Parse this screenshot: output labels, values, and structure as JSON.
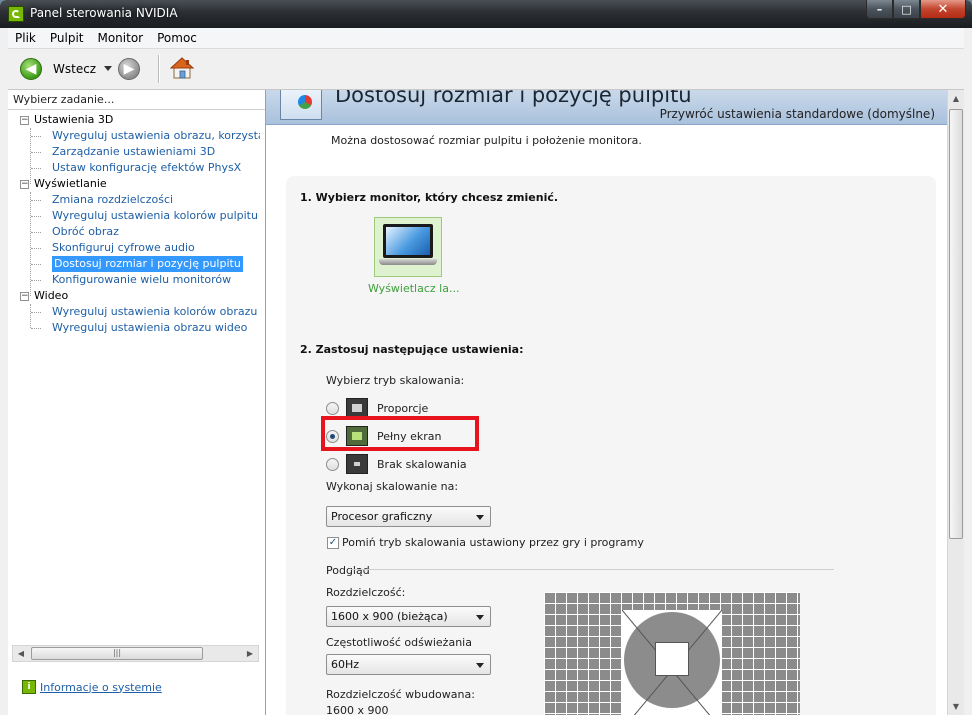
{
  "window": {
    "title": "Panel sterowania NVIDIA",
    "min": "–",
    "max": "□",
    "close": "✕"
  },
  "menu": [
    "Plik",
    "Pulpit",
    "Monitor",
    "Pomoc"
  ],
  "toolbar": {
    "back_label": "Wstecz"
  },
  "left": {
    "header": "Wybierz zadanie...",
    "tree": [
      {
        "label": "Ustawienia 3D",
        "type": "cat"
      },
      {
        "label": "Wyreguluj ustawienia obrazu, korzystając z",
        "type": "link"
      },
      {
        "label": "Zarządzanie ustawieniami 3D",
        "type": "link"
      },
      {
        "label": "Ustaw konfigurację efektów PhysX",
        "type": "link"
      },
      {
        "label": "Wyświetlanie",
        "type": "cat"
      },
      {
        "label": "Zmiana rozdzielczości",
        "type": "link"
      },
      {
        "label": "Wyreguluj ustawienia kolorów pulpitu",
        "type": "link"
      },
      {
        "label": "Obróć obraz",
        "type": "link"
      },
      {
        "label": "Skonfiguruj cyfrowe audio",
        "type": "link"
      },
      {
        "label": "Dostosuj rozmiar i pozycję pulpitu",
        "type": "link",
        "selected": true
      },
      {
        "label": "Konfigurowanie wielu monitorów",
        "type": "link"
      },
      {
        "label": "Wideo",
        "type": "cat"
      },
      {
        "label": "Wyreguluj ustawienia kolorów obrazu wideo",
        "type": "link"
      },
      {
        "label": "Wyreguluj ustawienia obrazu wideo",
        "type": "link"
      }
    ],
    "sysinfo": "Informacje o systemie"
  },
  "main": {
    "title": "Dostosuj rozmiar i pozycję pulpitu",
    "restore": "Przywróć ustawienia standardowe (domyślne)",
    "description": "Można dostosować rozmiar pulpitu i położenie monitora.",
    "step1": "1. Wybierz monitor, który chcesz zmienić.",
    "monitor_label": "Wyświetlacz la...",
    "step2": "2. Zastosuj następujące ustawienia:",
    "scaling_label": "Wybierz tryb skalowania:",
    "scaling_options": [
      {
        "label": "Proporcje",
        "selected": false
      },
      {
        "label": "Pełny ekran",
        "selected": true
      },
      {
        "label": "Brak skalowania",
        "selected": false
      }
    ],
    "perform_on_label": "Wykonaj skalowanie na:",
    "perform_on_value": "Procesor graficzny",
    "override_label": "Pomiń tryb skalowania ustawiony przez gry i programy",
    "override_checked": true,
    "preview_label": "Podgląd",
    "resolution_label": "Rozdzielczość:",
    "resolution_value": "1600 x 900 (bieżąca)",
    "refresh_label": "Częstotliwość odświeżania",
    "refresh_value": "60Hz",
    "native_label": "Rozdzielczość wbudowana:",
    "native_value": "1600 x 900"
  },
  "colors": {
    "highlight": "#e8141d",
    "nvidia_green": "#76b900",
    "selection": "#3399ff"
  }
}
